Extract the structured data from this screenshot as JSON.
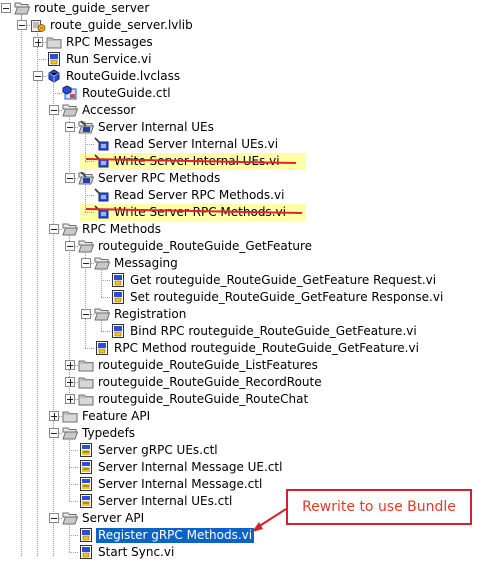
{
  "tree": {
    "nodes": [
      {
        "label": "route_guide_server",
        "level": 0,
        "icon": "folder-open-icon",
        "expander": "minus"
      },
      {
        "label": "route_guide_server.lvlib",
        "level": 1,
        "icon": "lvlib-icon",
        "expander": "minus"
      },
      {
        "label": "RPC Messages",
        "level": 2,
        "icon": "folder-closed-icon",
        "expander": "plus"
      },
      {
        "label": "Run Service.vi",
        "level": 2,
        "icon": "vi-icon",
        "expander": "none"
      },
      {
        "label": "RouteGuide.lvclass",
        "level": 2,
        "icon": "lvclass-icon",
        "expander": "minus"
      },
      {
        "label": "RouteGuide.ctl",
        "level": 3,
        "icon": "class-ctl-icon",
        "expander": "none"
      },
      {
        "label": "Accessor",
        "level": 3,
        "icon": "folder-open-icon",
        "expander": "minus"
      },
      {
        "label": "Server Internal UEs",
        "level": 4,
        "icon": "accessor-folder-icon",
        "expander": "minus"
      },
      {
        "label": "Read Server Internal UEs.vi",
        "level": 5,
        "icon": "accessor-vi-icon",
        "expander": "none"
      },
      {
        "label": "Write Server Internal UEs.vi",
        "level": 5,
        "icon": "accessor-vi-icon",
        "expander": "none"
      },
      {
        "label": "Server RPC Methods",
        "level": 4,
        "icon": "accessor-folder-icon",
        "expander": "minus"
      },
      {
        "label": "Read Server RPC Methods.vi",
        "level": 5,
        "icon": "accessor-vi-icon",
        "expander": "none"
      },
      {
        "label": "Write Server RPC Methods.vi",
        "level": 5,
        "icon": "accessor-vi-icon",
        "expander": "none"
      },
      {
        "label": "RPC Methods",
        "level": 3,
        "icon": "folder-open-icon",
        "expander": "minus"
      },
      {
        "label": "routeguide_RouteGuide_GetFeature",
        "level": 4,
        "icon": "folder-open-icon",
        "expander": "minus"
      },
      {
        "label": "Messaging",
        "level": 5,
        "icon": "folder-open-icon",
        "expander": "minus"
      },
      {
        "label": "Get routeguide_RouteGuide_GetFeature Request.vi",
        "level": 6,
        "icon": "vi-icon",
        "expander": "none"
      },
      {
        "label": "Set routeguide_RouteGuide_GetFeature Response.vi",
        "level": 6,
        "icon": "vi-icon",
        "expander": "none"
      },
      {
        "label": "Registration",
        "level": 5,
        "icon": "folder-open-icon",
        "expander": "minus"
      },
      {
        "label": "Bind RPC routeguide_RouteGuide_GetFeature.vi",
        "level": 6,
        "icon": "vi-icon",
        "expander": "none"
      },
      {
        "label": "RPC Method routeguide_RouteGuide_GetFeature.vi",
        "level": 5,
        "icon": "vi-icon",
        "expander": "none"
      },
      {
        "label": "routeguide_RouteGuide_ListFeatures",
        "level": 4,
        "icon": "folder-closed-icon",
        "expander": "plus"
      },
      {
        "label": "routeguide_RouteGuide_RecordRoute",
        "level": 4,
        "icon": "folder-closed-icon",
        "expander": "plus"
      },
      {
        "label": "routeguide_RouteGuide_RouteChat",
        "level": 4,
        "icon": "folder-closed-icon",
        "expander": "plus"
      },
      {
        "label": "Feature API",
        "level": 3,
        "icon": "folder-closed-icon",
        "expander": "plus"
      },
      {
        "label": "Typedefs",
        "level": 3,
        "icon": "folder-open-icon",
        "expander": "minus"
      },
      {
        "label": "Server gRPC UEs.ctl",
        "level": 4,
        "icon": "ctl-icon",
        "expander": "none"
      },
      {
        "label": "Server Internal Message UE.ctl",
        "level": 4,
        "icon": "ctl-icon",
        "expander": "none"
      },
      {
        "label": "Server Internal Message.ctl",
        "level": 4,
        "icon": "ctl-icon",
        "expander": "none"
      },
      {
        "label": "Server Internal UEs.ctl",
        "level": 4,
        "icon": "ctl-icon",
        "expander": "none"
      },
      {
        "label": "Server API",
        "level": 3,
        "icon": "folder-open-icon",
        "expander": "minus"
      },
      {
        "label": "Register gRPC Methods.vi",
        "level": 4,
        "icon": "vi-icon",
        "expander": "none",
        "selected": true
      },
      {
        "label": "Start Sync.vi",
        "level": 4,
        "icon": "vi-icon",
        "expander": "none"
      }
    ]
  },
  "callout": {
    "text": "Rewrite to use Bundle"
  },
  "colors": {
    "selection": "#0a64c8",
    "highlight": "#ffffa8",
    "strike": "#e0242b",
    "callout_border": "#d2232a",
    "callout_text": "#e03a28"
  }
}
